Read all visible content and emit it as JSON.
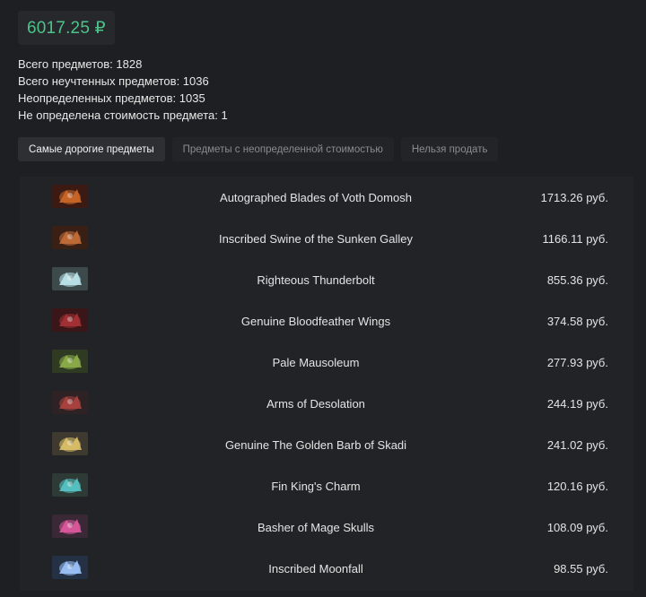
{
  "summary": {
    "total_value": "6017.25 ₽",
    "stats": [
      "Всего предметов: 1828",
      "Всего неучтенных предметов: 1036",
      "Неопределенных предметов: 1035",
      "Не определена стоимость предмета: 1"
    ]
  },
  "tabs": [
    {
      "label": "Самые дорогие предметы",
      "active": true
    },
    {
      "label": "Предметы с неопределенной стоимостью",
      "active": false
    },
    {
      "label": "Нельзя продать",
      "active": false
    }
  ],
  "items": [
    {
      "name": "Autographed Blades of Voth Domosh",
      "price": "1713.26 руб.",
      "icon": "voth-domosh-blades-icon",
      "thumb_bg": "#3a1a12",
      "thumb_fg": "#d06a2a"
    },
    {
      "name": "Inscribed Swine of the Sunken Galley",
      "price": "1166.11 руб.",
      "icon": "swine-sunken-galley-icon",
      "thumb_bg": "#3a2014",
      "thumb_fg": "#c8703a"
    },
    {
      "name": "Righteous Thunderbolt",
      "price": "855.36 руб.",
      "icon": "thunderbolt-icon",
      "thumb_bg": "#3c4a4c",
      "thumb_fg": "#bfe9ee"
    },
    {
      "name": "Genuine Bloodfeather Wings",
      "price": "374.58 руб.",
      "icon": "bloodfeather-wings-icon",
      "thumb_bg": "#3a1618",
      "thumb_fg": "#a83236"
    },
    {
      "name": "Pale Mausoleum",
      "price": "277.93 руб.",
      "icon": "pale-mausoleum-icon",
      "thumb_bg": "#2f3a22",
      "thumb_fg": "#8fb04a"
    },
    {
      "name": "Arms of Desolation",
      "price": "244.19 руб.",
      "icon": "arms-of-desolation-icon",
      "thumb_bg": "#2e2224",
      "thumb_fg": "#b04440"
    },
    {
      "name": "Genuine The Golden Barb of Skadi",
      "price": "241.02 руб.",
      "icon": "golden-barb-skadi-icon",
      "thumb_bg": "#3e3a30",
      "thumb_fg": "#e0c46a"
    },
    {
      "name": "Fin King's Charm",
      "price": "120.16 руб.",
      "icon": "fin-kings-charm-icon",
      "thumb_bg": "#2e3a36",
      "thumb_fg": "#58c8c8"
    },
    {
      "name": "Basher of Mage Skulls",
      "price": "108.09 руб.",
      "icon": "basher-mage-skulls-icon",
      "thumb_bg": "#3a2836",
      "thumb_fg": "#e05aa0"
    },
    {
      "name": "Inscribed Moonfall",
      "price": "98.55 руб.",
      "icon": "moonfall-icon",
      "thumb_bg": "#243044",
      "thumb_fg": "#a0c8ff"
    }
  ]
}
